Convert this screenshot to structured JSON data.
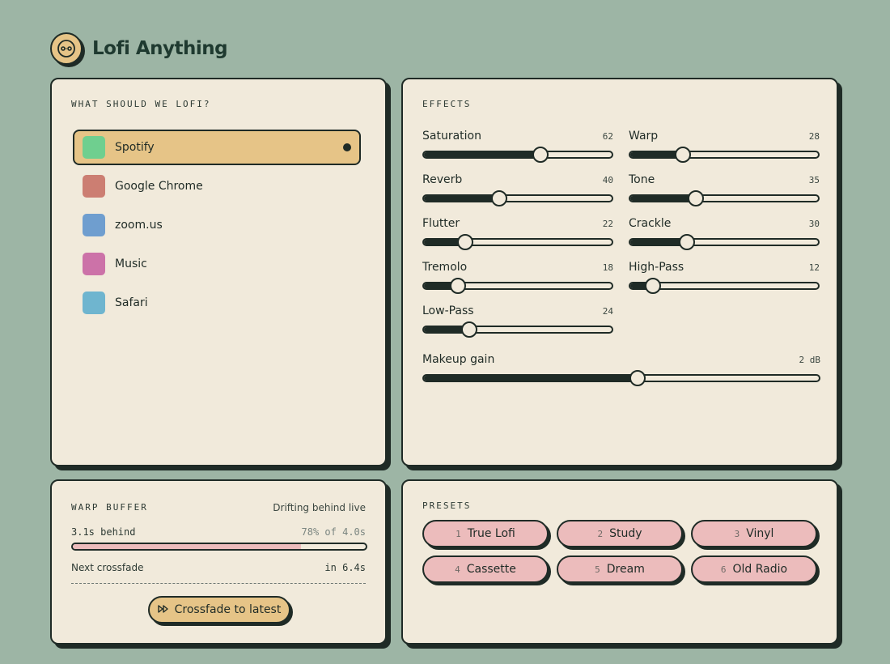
{
  "app": {
    "title": "Lofi Anything",
    "logo_icon": "cassette-reel-icon"
  },
  "source": {
    "heading": "WHAT SHOULD WE LOFI?",
    "items": [
      {
        "label": "Spotify",
        "color": "#6fcf8f",
        "active": true
      },
      {
        "label": "Google Chrome",
        "color": "#cc7e72",
        "active": false
      },
      {
        "label": "zoom.us",
        "color": "#6f9ecf",
        "active": false
      },
      {
        "label": "Music",
        "color": "#cc72a8",
        "active": false
      },
      {
        "label": "Safari",
        "color": "#6fb5cf",
        "active": false
      }
    ]
  },
  "effects": {
    "heading": "EFFECTS",
    "sliders": [
      {
        "label": "Saturation",
        "value": 62,
        "display": "62"
      },
      {
        "label": "Warp",
        "value": 28,
        "display": "28"
      },
      {
        "label": "Reverb",
        "value": 40,
        "display": "40"
      },
      {
        "label": "Tone",
        "value": 35,
        "display": "35"
      },
      {
        "label": "Flutter",
        "value": 22,
        "display": "22"
      },
      {
        "label": "Crackle",
        "value": 30,
        "display": "30"
      },
      {
        "label": "Tremolo",
        "value": 18,
        "display": "18"
      },
      {
        "label": "High-Pass",
        "value": 12,
        "display": "12"
      },
      {
        "label": "Low-Pass",
        "value": 24,
        "display": "24"
      }
    ],
    "makeup": {
      "label": "Makeup gain",
      "value": 0.54,
      "display": "2 dB"
    }
  },
  "warp": {
    "heading": "WARP BUFFER",
    "status": "Drifting behind live",
    "behind": "3.1s behind",
    "percent_text": "78% of 4.0s",
    "fill": 0.78,
    "next_label": "Next crossfade",
    "next_value": "in 6.4s",
    "button_label": "Crossfade to latest",
    "button_icon": "fast-forward-icon"
  },
  "presets": {
    "heading": "PRESETS",
    "items": [
      {
        "num": "1",
        "label": "True Lofi"
      },
      {
        "num": "2",
        "label": "Study"
      },
      {
        "num": "3",
        "label": "Vinyl"
      },
      {
        "num": "4",
        "label": "Cassette"
      },
      {
        "num": "5",
        "label": "Dream"
      },
      {
        "num": "6",
        "label": "Old Radio"
      }
    ]
  },
  "colors": {
    "background": "#9db5a5",
    "card": "#f1eadb",
    "ink": "#1f2b26",
    "accent_gold": "#e6c487",
    "accent_pink": "#ecbcbc"
  }
}
